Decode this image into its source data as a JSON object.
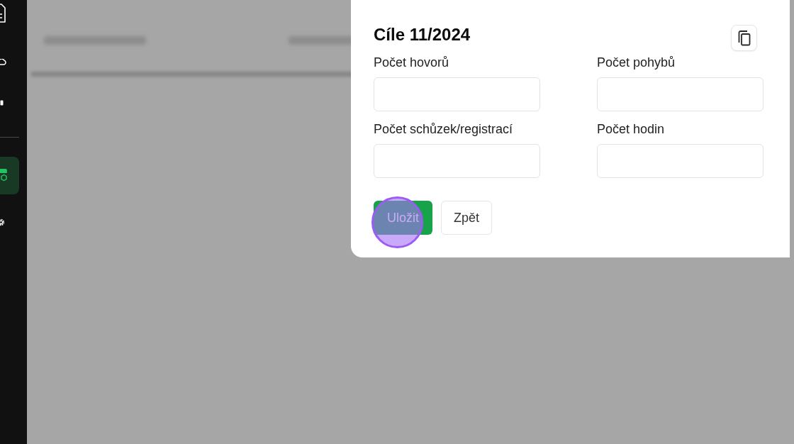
{
  "sidebar": {
    "groups": [
      {
        "items": [
          {
            "kind": "document",
            "selected": false
          },
          {
            "kind": "cloud",
            "selected": false
          },
          {
            "kind": "phone",
            "selected": false
          }
        ]
      },
      {
        "items": [
          {
            "kind": "cube",
            "selected": true
          },
          {
            "kind": "gear",
            "selected": false
          }
        ]
      }
    ]
  },
  "dialog": {
    "title": "Cíle 11/2024",
    "fields": [
      {
        "label": "Počet hovorů"
      },
      {
        "label": "Počet pohybů"
      },
      {
        "label": "Počet schůzek/registrací"
      },
      {
        "label": "Počet hodin"
      }
    ],
    "buttons": [
      {
        "label": "Uložit",
        "kind": "primary"
      },
      {
        "label": "Zpět",
        "kind": "secondary"
      }
    ]
  }
}
